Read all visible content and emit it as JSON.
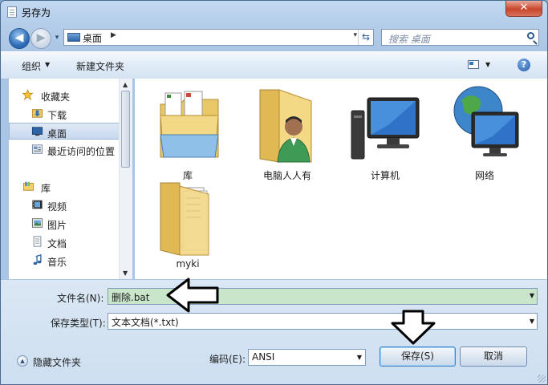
{
  "window": {
    "title": "另存为",
    "close_symbol": "✕"
  },
  "nav": {
    "back_symbol": "◀",
    "forward_symbol": "▶",
    "history_symbol": "▾",
    "address_path": "桌面",
    "address_separator": "▶",
    "address_dropdown_symbol": "▾",
    "refresh_symbol": "⇆",
    "search_placeholder": "搜索 桌面"
  },
  "toolbar": {
    "organize_label": "组织",
    "organize_arrow": "▼",
    "new_folder_label": "新建文件夹",
    "view_arrow": "▼",
    "help_symbol": "?"
  },
  "sidebar": {
    "favorites": {
      "label": "收藏夹",
      "icon": "star-icon"
    },
    "items_favorites": [
      {
        "label": "下载",
        "icon": "download-folder-icon"
      },
      {
        "label": "桌面",
        "icon": "desktop-icon",
        "selected": true
      },
      {
        "label": "最近访问的位置",
        "icon": "recent-places-icon"
      }
    ],
    "libraries": {
      "label": "库",
      "icon": "library-icon"
    },
    "items_libraries": [
      {
        "label": "视频",
        "icon": "video-icon"
      },
      {
        "label": "图片",
        "icon": "picture-icon"
      },
      {
        "label": "文档",
        "icon": "document-icon"
      },
      {
        "label": "音乐",
        "icon": "music-icon"
      }
    ],
    "scroll_up": "▲",
    "scroll_down": "▼"
  },
  "content": {
    "items": [
      {
        "label": "库",
        "icon": "libraries-folder-icon"
      },
      {
        "label": "电脑人人有",
        "icon": "user-folder-icon"
      },
      {
        "label": "计算机",
        "icon": "computer-icon"
      },
      {
        "label": "网络",
        "icon": "network-icon"
      },
      {
        "label": "myki",
        "icon": "folder-icon"
      }
    ]
  },
  "form": {
    "filename_label": "文件名(N):",
    "filename_value": "删除.bat",
    "filetype_label": "保存类型(T):",
    "filetype_value": "文本文档(*.txt)",
    "dropdown_symbol": "▼",
    "hide_folders_symbol": "▲",
    "hide_folders_label": "隐藏文件夹",
    "encoding_label": "编码(E):",
    "encoding_value": "ANSI",
    "save_label": "保存(S)",
    "cancel_label": "取消"
  },
  "colors": {
    "filename_highlight": "#c9e6cb",
    "selection": "#c7d9ef",
    "accent": "#2f6fb8"
  }
}
